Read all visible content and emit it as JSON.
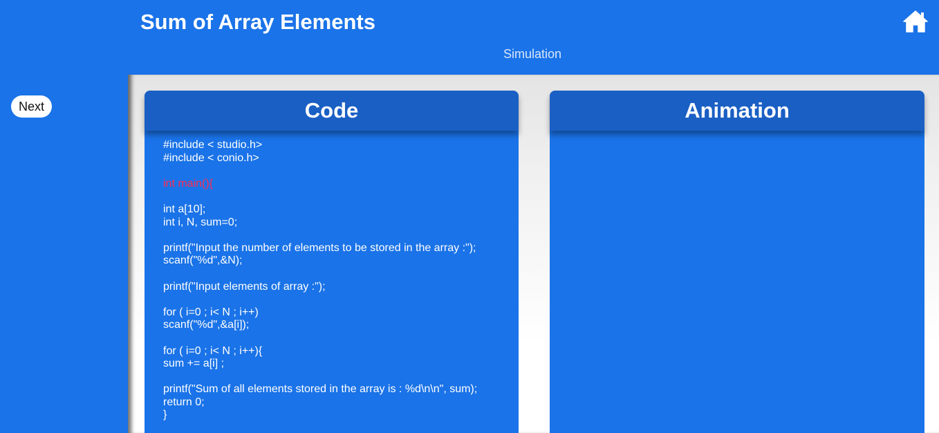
{
  "header": {
    "title": "Sum of Array Elements",
    "subtitle": "Simulation",
    "home_icon": "home-icon"
  },
  "sidebar": {
    "next_label": "Next"
  },
  "panels": {
    "code_title": "Code",
    "animation_title": "Animation"
  },
  "code": {
    "lines": [
      "#include < studio.h>",
      "#include < conio.h>",
      "",
      "int main(){",
      "",
      "int a[10];",
      "int i, N, sum=0;",
      "",
      "printf(\"Input the number of elements to be stored in the array :\");",
      "scanf(\"%d\",&N);",
      "",
      "printf(\"Input elements of array :\");",
      "",
      "for ( i=0 ; i< N ; i++)",
      "scanf(\"%d\",&a[i]);",
      "",
      "for ( i=0 ; i< N ; i++){",
      "sum += a[i] ;",
      "",
      "printf(\"Sum of all elements stored in the array is : %d\\n\\n\", sum);",
      "return 0;",
      "}"
    ],
    "highlight_line": 3,
    "highlight_color": "#ff2d55"
  },
  "colors": {
    "primary": "#1a73e8",
    "header_bar": "#1a5fc4"
  }
}
